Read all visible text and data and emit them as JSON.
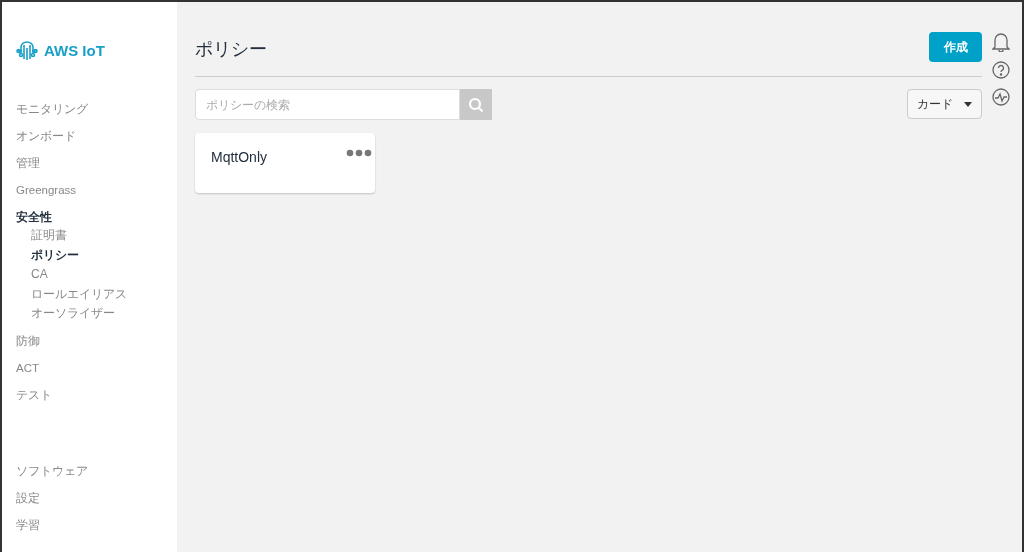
{
  "sidebar": {
    "logo": "AWS IoT",
    "groups": [
      {
        "items": [
          {
            "label": "モニタリング",
            "selected": false
          },
          {
            "label": "オンボード",
            "selected": false
          },
          {
            "label": "管理",
            "selected": false
          },
          {
            "label": "Greengrass",
            "selected": false
          },
          {
            "label": "安全性",
            "expanded": true,
            "children": [
              {
                "label": "証明書",
                "selected": false
              },
              {
                "label": "ポリシー",
                "selected": true
              },
              {
                "label": "CA",
                "selected": false
              },
              {
                "label": "ロールエイリアス",
                "selected": false
              },
              {
                "label": "オーソライザー",
                "selected": false
              }
            ]
          },
          {
            "label": "防御",
            "selected": false
          },
          {
            "label": "ACT",
            "selected": false
          },
          {
            "label": "テスト",
            "selected": false
          }
        ]
      },
      {
        "items": [
          {
            "label": "ソフトウェア",
            "selected": false
          },
          {
            "label": "設定",
            "selected": false
          },
          {
            "label": "学習",
            "selected": false
          }
        ]
      }
    ]
  },
  "header": {
    "title": "ポリシー",
    "create_button": "作成"
  },
  "search": {
    "placeholder": "ポリシーの検索"
  },
  "view_select": {
    "value": "カード"
  },
  "cards": [
    {
      "title": "MqttOnly"
    }
  ]
}
